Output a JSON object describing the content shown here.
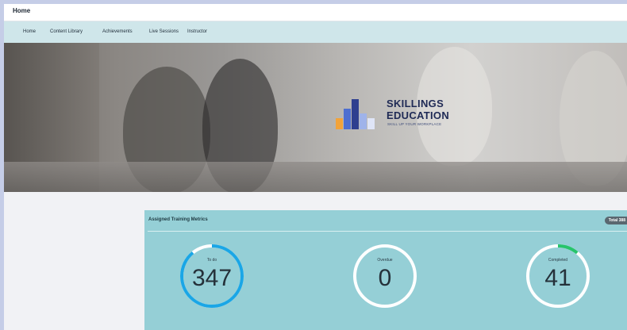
{
  "header": {
    "title": "Home"
  },
  "nav": {
    "items": [
      {
        "label": "Home"
      },
      {
        "label": "Content Library"
      },
      {
        "label": "Achievements"
      },
      {
        "label": "Live Sessions"
      },
      {
        "label": "Instructor"
      }
    ]
  },
  "hero": {
    "logo": {
      "line1": "SKILLINGS",
      "line2": "EDUCATION",
      "tagline": "SKILL UP YOUR WORKPLACE",
      "bar_colors": [
        "#f2a33a",
        "#4e6fd0",
        "#2e3f8f",
        "#9fb3ea",
        "#dfe5f7"
      ]
    }
  },
  "metrics": {
    "title": "Assigned Training Metrics",
    "total_badge": "Total 388",
    "items": [
      {
        "label": "To do",
        "value": "347",
        "fraction": 0.89,
        "color": "#1aa6e6"
      },
      {
        "label": "Overdue",
        "value": "0",
        "fraction": 0,
        "color": "#ffffff"
      },
      {
        "label": "Completed",
        "value": "41",
        "fraction": 0.11,
        "color": "#27c46b"
      }
    ]
  }
}
